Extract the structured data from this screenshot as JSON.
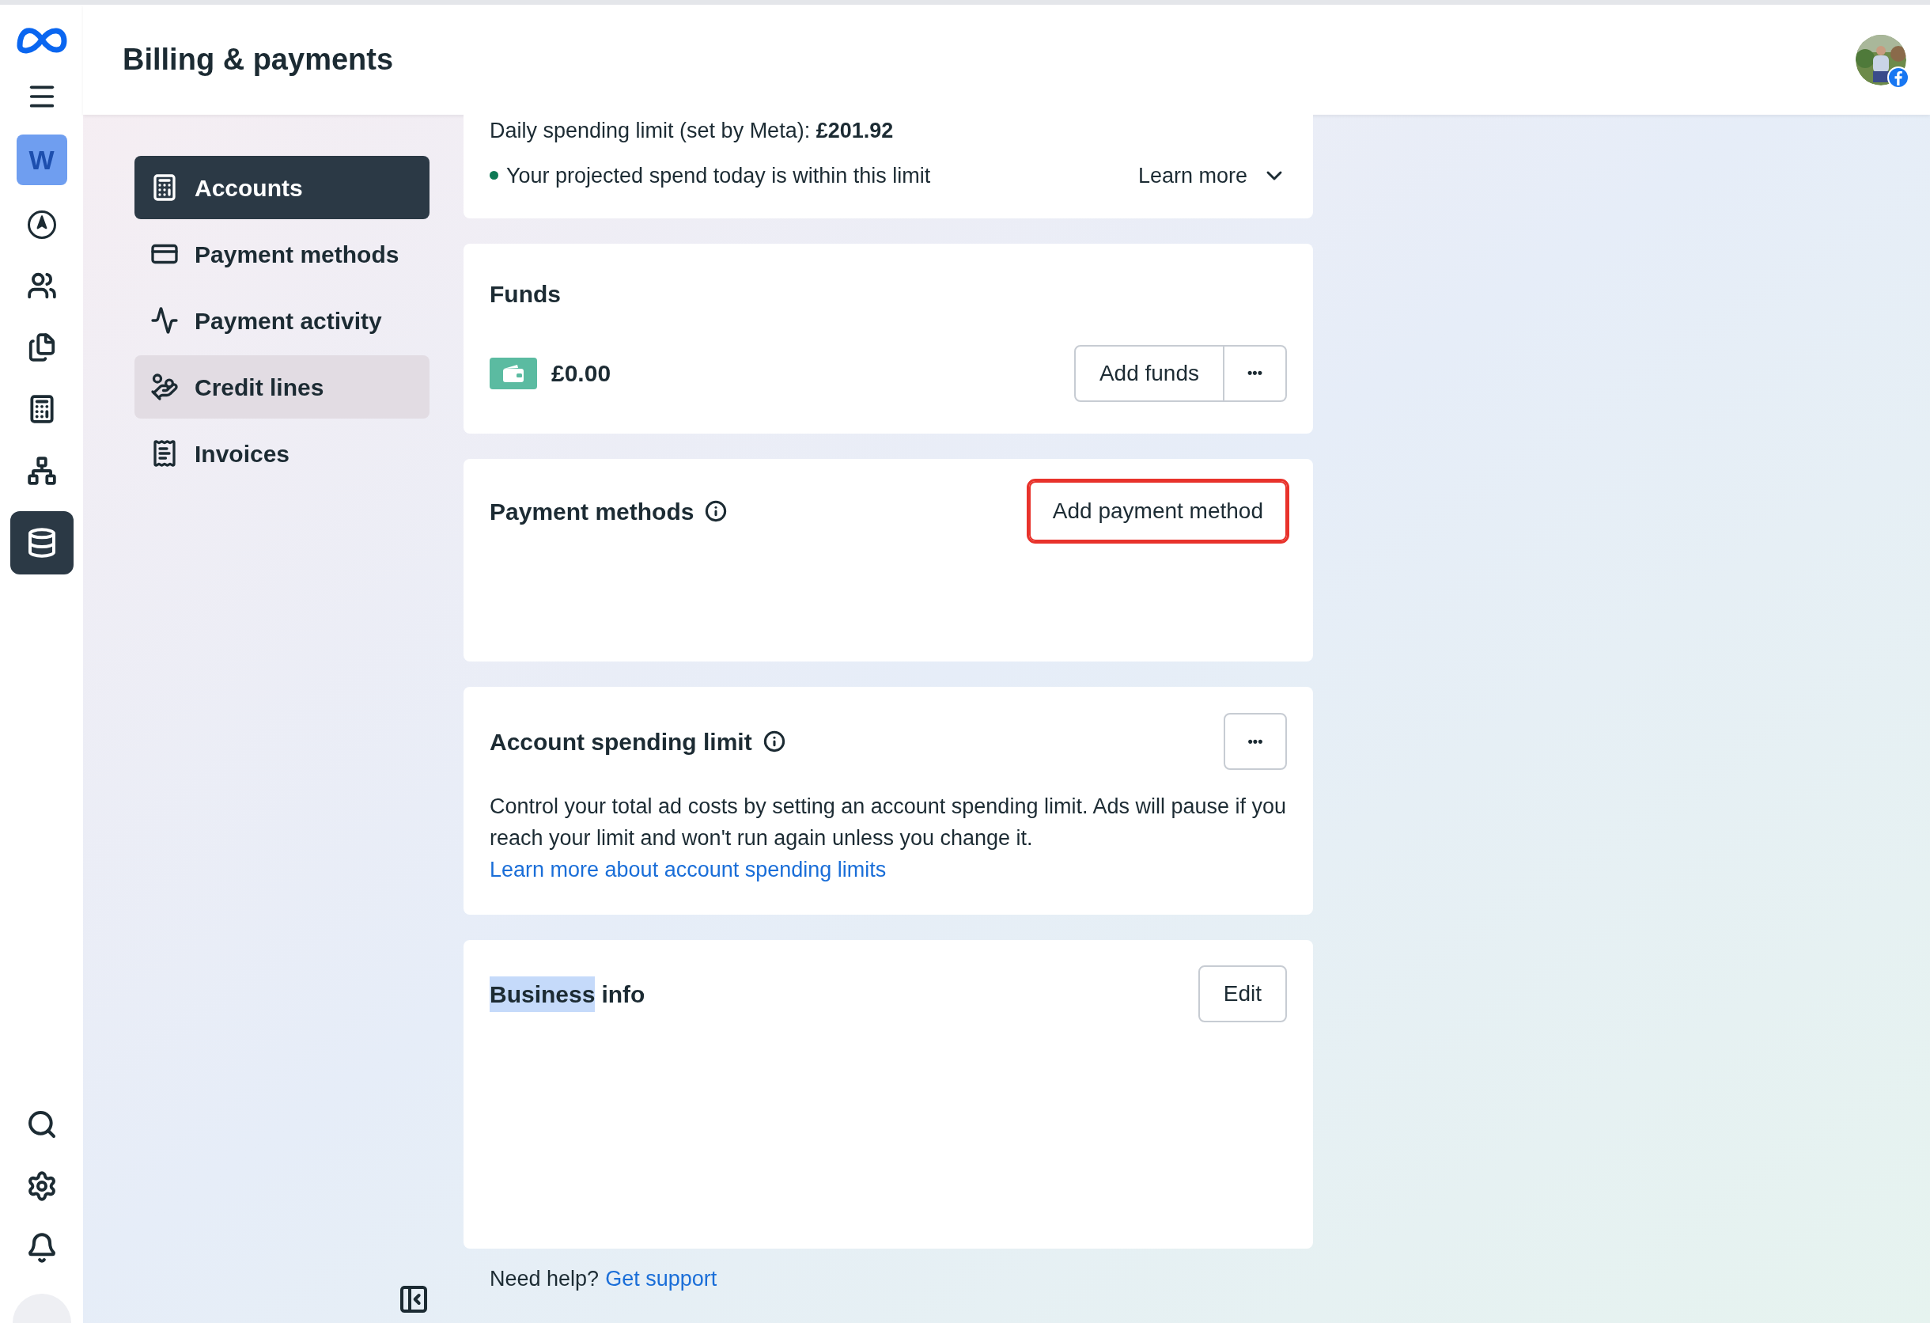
{
  "rail": {
    "items": [
      {
        "kind": "logo",
        "selected": false
      },
      {
        "kind": "menu",
        "selected": false
      },
      {
        "kind": "workspace",
        "label": "W",
        "selected": false
      },
      {
        "kind": "navigate",
        "selected": false
      },
      {
        "kind": "people",
        "selected": false
      },
      {
        "kind": "documents",
        "selected": false
      },
      {
        "kind": "accounts",
        "selected": false
      },
      {
        "kind": "network",
        "selected": false
      },
      {
        "kind": "billing",
        "selected": true
      }
    ],
    "bottom": [
      {
        "kind": "search"
      },
      {
        "kind": "settings"
      },
      {
        "kind": "notifications"
      },
      {
        "kind": "profile"
      }
    ]
  },
  "header": {
    "title": "Billing & payments"
  },
  "sidebar": {
    "items": [
      {
        "label": "Accounts",
        "selected": true,
        "hovered": false
      },
      {
        "label": "Payment methods",
        "selected": false,
        "hovered": false
      },
      {
        "label": "Payment activity",
        "selected": false,
        "hovered": false
      },
      {
        "label": "Credit lines",
        "selected": false,
        "hovered": true
      },
      {
        "label": "Invoices",
        "selected": false,
        "hovered": false
      }
    ]
  },
  "daily_limit": {
    "text": "Daily spending limit (set by Meta): **£201.92**",
    "status": "Your projected spend today is within this limit",
    "within_limit": true,
    "learn_more": "Learn more",
    "expanded": false
  },
  "funds": {
    "title": "Funds",
    "balance": "£0.00",
    "add_button": "Add funds",
    "more_button": "•••"
  },
  "payment_methods": {
    "title": "Payment methods",
    "add_button": "Add payment method",
    "annotated": true
  },
  "spending_limit": {
    "title": "Account spending limit",
    "more_button": "•••",
    "description": "Control your total ad costs by setting an account spending limit. Ads will pause if you reach your limit and won't run again unless you change it.",
    "link": "Learn more about account spending limits"
  },
  "business_info": {
    "title_parts": [
      {
        "text": "Business",
        "selected": true
      },
      {
        "text": "info",
        "selected": false
      }
    ],
    "edit_button": "Edit"
  },
  "footer": {
    "text": "Need help?",
    "link": "Get support"
  }
}
